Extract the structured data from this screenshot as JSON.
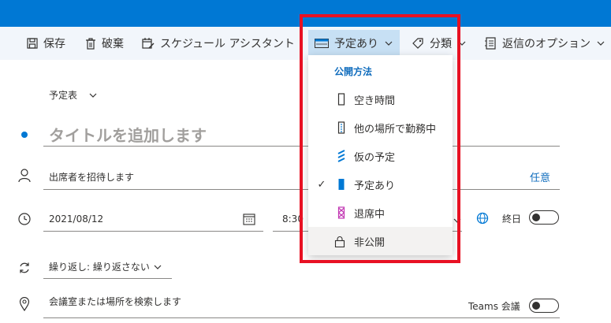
{
  "toolbar": {
    "save_label": "保存",
    "discard_label": "破棄",
    "scheduling_label": "スケジュール アシスタント",
    "busy_status_label": "予定あり",
    "categorize_label": "分類",
    "response_options_label": "返信のオプション"
  },
  "form": {
    "calendar_label": "予定表",
    "title_placeholder": "タイトルを追加します",
    "attendees_placeholder": "出席者を招待します",
    "optional_label": "任意",
    "start_date": "2021/08/12",
    "start_time_partial": "8:30",
    "all_day_label": "終日",
    "repeat_label": "繰り返し: 繰り返さない",
    "location_placeholder": "会議室または場所を検索します",
    "teams_label": "Teams 会議"
  },
  "menu": {
    "header": "公開方法",
    "items": [
      {
        "label": "空き時間",
        "icon": "free-icon",
        "checked": false
      },
      {
        "label": "他の場所で勤務中",
        "icon": "working-elsewhere-icon",
        "checked": false
      },
      {
        "label": "仮の予定",
        "icon": "tentative-icon",
        "checked": false
      },
      {
        "label": "予定あり",
        "icon": "busy-icon",
        "checked": true
      },
      {
        "label": "退席中",
        "icon": "away-icon",
        "checked": false
      },
      {
        "label": "非公開",
        "icon": "lock-icon",
        "checked": false
      }
    ]
  },
  "colors": {
    "brand": "#0078d4",
    "toolbar_bg": "#f2f6fb",
    "active_bg": "#c7e0f4",
    "accent_text": "#0f6cbd",
    "highlight_box": "#e81123",
    "away_icon": "#c239b3"
  }
}
